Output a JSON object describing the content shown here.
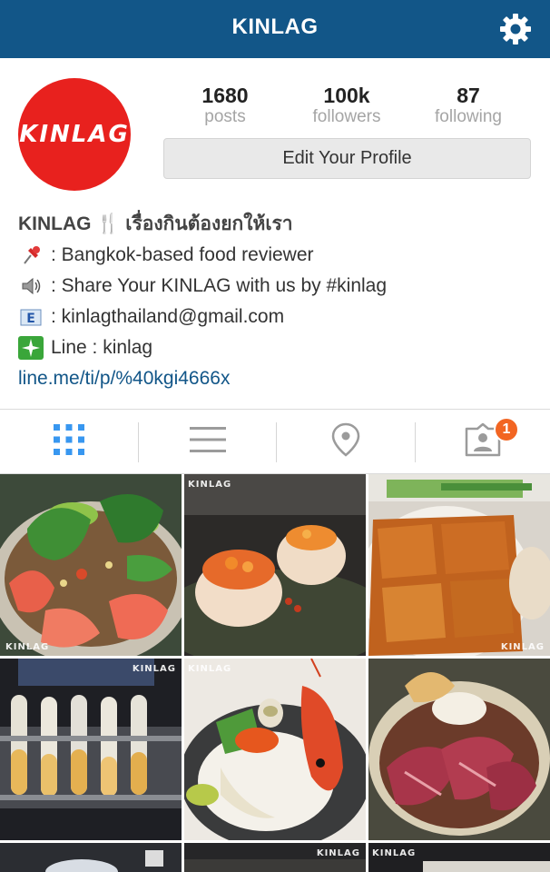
{
  "header": {
    "title": "KINLAG",
    "settings_icon": "gear-icon"
  },
  "profile": {
    "avatar_text": "KINLAG",
    "stats": [
      {
        "value": "1680",
        "label": "posts"
      },
      {
        "value": "100k",
        "label": "followers"
      },
      {
        "value": "87",
        "label": "following"
      }
    ],
    "edit_button": "Edit Your Profile",
    "bio": {
      "name": "KINLAG 🍴 เรื่องกินต้องยกให้เรา",
      "lines": [
        {
          "icon": "pushpin-icon",
          "text": ": Bangkok-based food reviewer"
        },
        {
          "icon": "speaker-icon",
          "text": ": Share Your KINLAG with us by #kinlag"
        },
        {
          "icon": "email-icon",
          "text": ": kinlagthailand@gmail.com"
        },
        {
          "icon": "sparkle-icon",
          "text": " Line : kinlag"
        }
      ],
      "link": "line.me/ti/p/%40kgi4666x"
    }
  },
  "tabs": {
    "items": [
      "grid-view",
      "list-view",
      "location",
      "tagged-photos"
    ],
    "tagged_badge": "1"
  },
  "photos": {
    "watermark": "KINLAG",
    "items": [
      "spicy salmon salad",
      "scallops with ikura",
      "crispy pork skin platter",
      "layered drinks in test tubes",
      "scallop and shrimp sashimi",
      "seared beef on rice",
      "photo",
      "photo",
      "photo"
    ]
  },
  "colors": {
    "header_bg": "#125688",
    "link": "#125688",
    "badge": "#f26522",
    "avatar_bg": "#e8211e"
  }
}
